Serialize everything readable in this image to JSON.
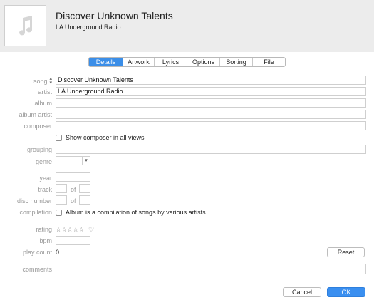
{
  "header": {
    "artwork_icon": "music-note-icon",
    "title": "Discover Unknown Talents",
    "subtitle": "LA Underground Radio"
  },
  "tabs": [
    {
      "label": "Details",
      "active": true
    },
    {
      "label": "Artwork",
      "active": false
    },
    {
      "label": "Lyrics",
      "active": false
    },
    {
      "label": "Options",
      "active": false
    },
    {
      "label": "Sorting",
      "active": false
    },
    {
      "label": "File",
      "active": false
    }
  ],
  "fields": {
    "song": {
      "label": "song",
      "value": "Discover Unknown Talents",
      "sort_icon": "updown-arrows-icon"
    },
    "artist": {
      "label": "artist",
      "value": "LA Underground Radio"
    },
    "album": {
      "label": "album",
      "value": ""
    },
    "album_artist": {
      "label": "album artist",
      "value": ""
    },
    "composer": {
      "label": "composer",
      "value": ""
    },
    "show_composer": {
      "label": "Show composer in all views",
      "checked": false
    },
    "grouping": {
      "label": "grouping",
      "value": ""
    },
    "genre": {
      "label": "genre",
      "value": ""
    },
    "year": {
      "label": "year",
      "value": ""
    },
    "track": {
      "label": "track",
      "value": "",
      "of_label": "of",
      "of_value": ""
    },
    "disc_number": {
      "label": "disc number",
      "value": "",
      "of_label": "of",
      "of_value": ""
    },
    "compilation": {
      "label": "compilation",
      "checkbox_label": "Album is a compilation of songs by various artists",
      "checked": false
    },
    "rating": {
      "label": "rating",
      "stars": "☆☆☆☆☆",
      "value": 0,
      "heart": "♡"
    },
    "bpm": {
      "label": "bpm",
      "value": ""
    },
    "play_count": {
      "label": "play count",
      "value": "0",
      "reset_label": "Reset"
    },
    "comments": {
      "label": "comments",
      "value": ""
    }
  },
  "footer": {
    "cancel_label": "Cancel",
    "ok_label": "OK"
  },
  "colors": {
    "accent": "#3b8ee8",
    "header_bg": "#ececec",
    "label_gray": "#9a9a9a"
  }
}
